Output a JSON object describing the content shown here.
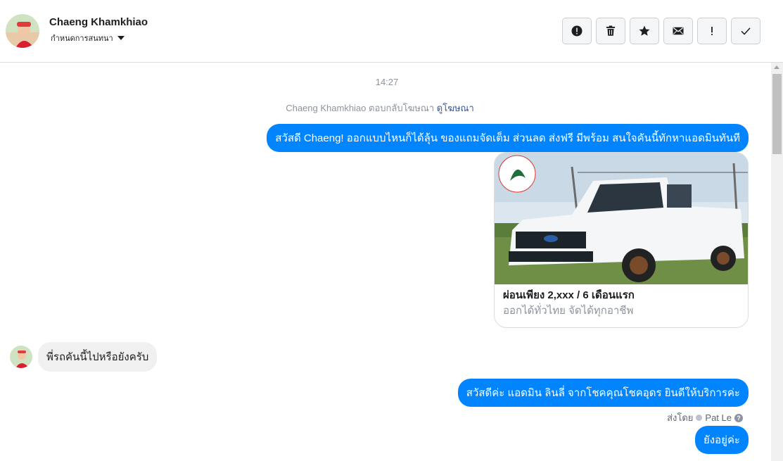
{
  "header": {
    "contact_name": "Chaeng Khamkhiao",
    "assign_label": "กำหนดการสนทนา"
  },
  "actions": [
    {
      "name": "mark-spam",
      "icon": "alert-circle-icon"
    },
    {
      "name": "delete",
      "icon": "trash-icon"
    },
    {
      "name": "star",
      "icon": "star-icon"
    },
    {
      "name": "mark-unread",
      "icon": "envelope-icon"
    },
    {
      "name": "important",
      "icon": "exclamation-icon"
    },
    {
      "name": "mark-done",
      "icon": "check-icon"
    }
  ],
  "thread": {
    "timestamp": "14:27",
    "ad_reply": {
      "text": "Chaeng Khamkhiao ตอบกลับโฆษณา",
      "link": "ดูโฆษณา"
    },
    "messages": [
      {
        "direction": "out",
        "text": "สวัสดี Chaeng! ออกแบบไหนก็ได้ลุ้น ของแถมจัดเต็ม ส่วนลด ส่งฟรี มีพร้อม สนใจคันนี้ทักหาแอดมินทันที"
      },
      {
        "direction": "in",
        "text": "พี่รถคันนี้ไปหรือยังครับ"
      },
      {
        "direction": "out",
        "text": "สวัสดีค่ะ แอดมิน ลินลี่ จากโชคคุณโชคอุดร ยินดีให้บริการค่ะ"
      },
      {
        "direction": "out",
        "text": "ยังอยู่ค่ะ"
      }
    ],
    "ad_card": {
      "title": "ผ่อนเพียง 2,xxx / 6 เดือนแรก",
      "subtitle": "ออกได้ทั่วไทย จัดได้ทุกอาชีพ"
    },
    "sent_by": {
      "label": "ส่งโดย",
      "agent": "Pat Le"
    }
  },
  "colors": {
    "outgoing_bubble": "#0084ff",
    "incoming_bubble": "#f1f0f0",
    "link": "#385898"
  }
}
